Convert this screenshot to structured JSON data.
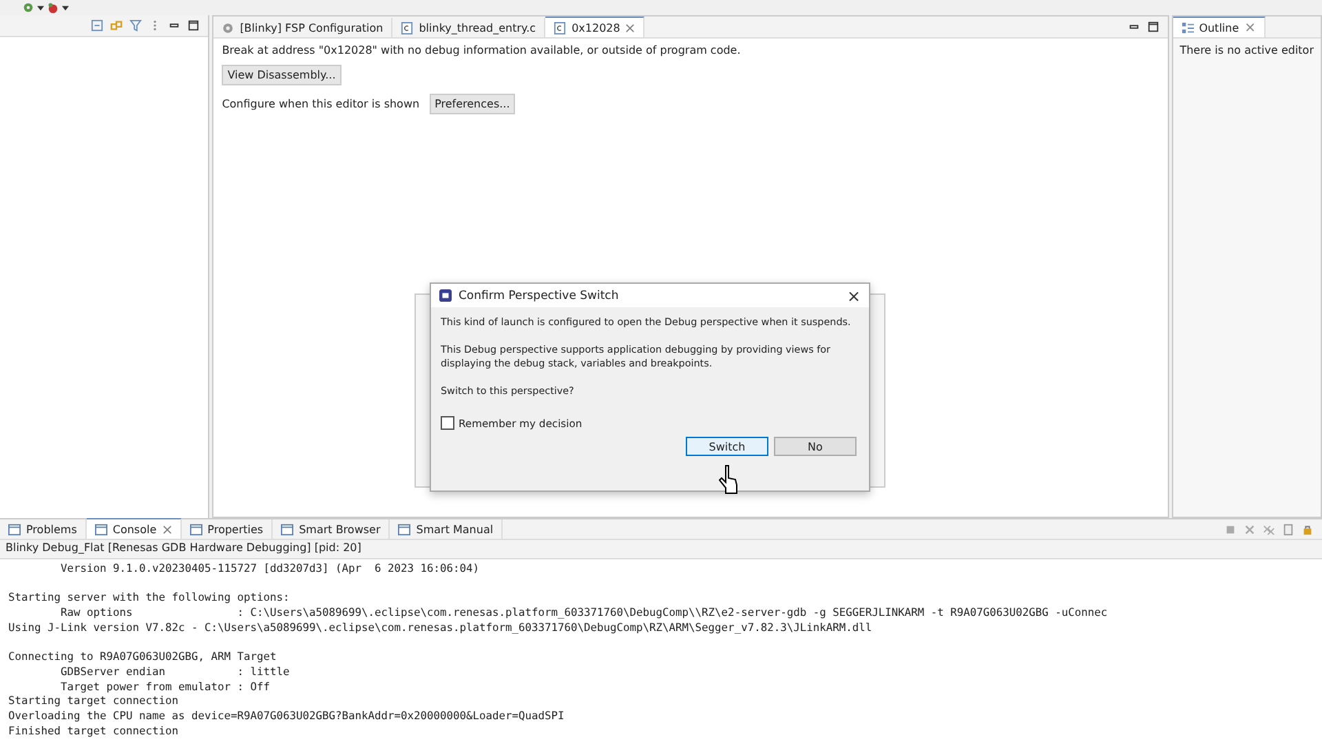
{
  "editor": {
    "tabs": [
      {
        "label": "[Blinky] FSP Configuration",
        "kind": "config",
        "selected": false,
        "closable": false
      },
      {
        "label": "blinky_thread_entry.c",
        "kind": "source",
        "selected": false,
        "closable": false
      },
      {
        "label": "0x12028",
        "kind": "source",
        "selected": true,
        "closable": true
      }
    ],
    "message": "Break at address \"0x12028\" with no debug information available, or outside of program code.",
    "disassembly_button": "View Disassembly...",
    "configure_label": "Configure when this editor is shown",
    "preferences_button": "Preferences..."
  },
  "outline": {
    "tab": {
      "label": "Outline",
      "close": "×"
    },
    "message": "There is no active editor"
  },
  "dialog": {
    "title": "Confirm Perspective Switch",
    "close": "×",
    "paragraphs": [
      "This kind of launch is configured to open the Debug perspective when it suspends.",
      "This Debug perspective supports application debugging by providing views for displaying the debug stack, variables and breakpoints.",
      "Switch to this perspective?"
    ],
    "remember": {
      "label": "Remember my decision",
      "checked": false
    },
    "buttons": [
      {
        "label": "Switch",
        "selected": true
      },
      {
        "label": "No",
        "selected": false
      }
    ]
  },
  "console": {
    "tabs": [
      {
        "label": "Problems",
        "selected": false,
        "closable": false
      },
      {
        "label": "Console",
        "selected": true,
        "closable": true
      },
      {
        "label": "Properties",
        "selected": false,
        "closable": false
      },
      {
        "label": "Smart Browser",
        "selected": false,
        "closable": false
      },
      {
        "label": "Smart Manual",
        "selected": false,
        "closable": false
      }
    ],
    "session": "Blinky Debug_Flat [Renesas GDB Hardware Debugging]  [pid: 20]",
    "blocks": [
      [
        "        Version 9.1.0.v20230405-115727 [dd3207d3] (Apr  6 2023 16:06:04)"
      ],
      [
        "Starting server with the following options:",
        "        Raw options                : C:\\Users\\a5089699\\.eclipse\\com.renesas.platform_603371760\\DebugComp\\\\RZ\\e2-server-gdb -g SEGGERJLINKARM -t R9A07G063U02GBG -uConnec",
        "Using J-Link version V7.82c - C:\\Users\\a5089699\\.eclipse\\com.renesas.platform_603371760\\DebugComp\\RZ\\ARM\\Segger_v7.82.3\\JLinkARM.dll"
      ],
      [
        "Connecting to R9A07G063U02GBG, ARM Target",
        "        GDBServer endian           : little",
        "        Target power from emulator : Off",
        "Starting target connection",
        "Overloading the CPU name as device=R9A07G063U02GBG?BankAddr=0x20000000&Loader=QuadSPI",
        "Finished target connection"
      ]
    ]
  }
}
